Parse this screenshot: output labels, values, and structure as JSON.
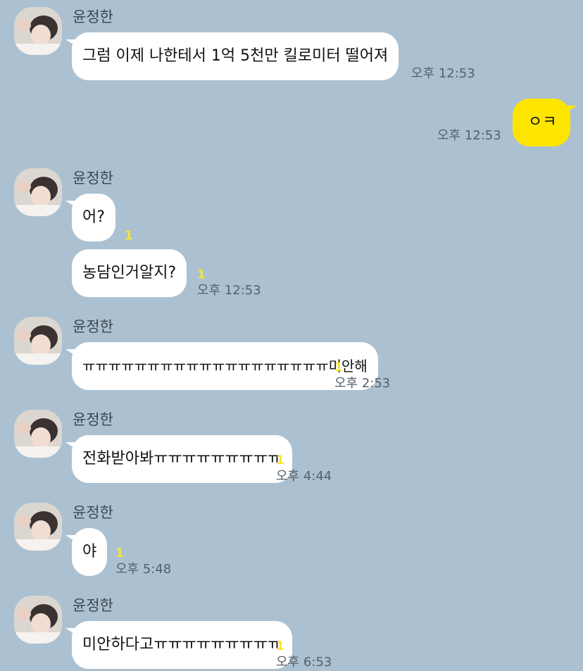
{
  "contact": {
    "name": "윤정한"
  },
  "messages": [
    {
      "text": "그럼 이제 나한테서 1억 5천만 킬로미터 떨어져",
      "time": "오후 12:53"
    },
    {
      "text": "ㅇㅋ",
      "time": "오후 12:53"
    },
    {
      "text": "어?",
      "unread": "1"
    },
    {
      "text": "농담인거알지?",
      "unread": "1",
      "time": "오후 12:53"
    },
    {
      "text": "ㅠㅠㅠㅠㅠㅠㅠㅠㅠㅠㅠㅠㅠㅠㅠㅠㅠㅠㅠ미안해",
      "unread": "1",
      "time": "오후 2:53"
    },
    {
      "text": "전화받아봐ㅠㅠㅠㅠㅠㅠㅠㅠㅠ",
      "unread": "1",
      "time": "오후 4:44"
    },
    {
      "text": "야",
      "unread": "1",
      "time": "오후 5:48"
    },
    {
      "text": "미안하다고ㅠㅠㅠㅠㅠㅠㅠㅠㅠ",
      "unread": "1",
      "time": "오후 6:53"
    }
  ]
}
